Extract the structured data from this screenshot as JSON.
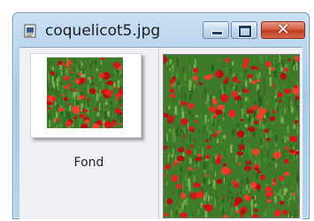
{
  "window": {
    "title": "coquelicot5.jpg",
    "controls": {
      "minimize": "minimize",
      "maximize": "maximize",
      "close": "close"
    }
  },
  "thumbnail": {
    "label": "Fond",
    "image_subject": "poppy field"
  },
  "preview": {
    "image_subject": "poppy field"
  },
  "colors": {
    "field_green": "#3f7a2a",
    "poppy_red": "#d2161a",
    "close_red": "#c23b20"
  }
}
